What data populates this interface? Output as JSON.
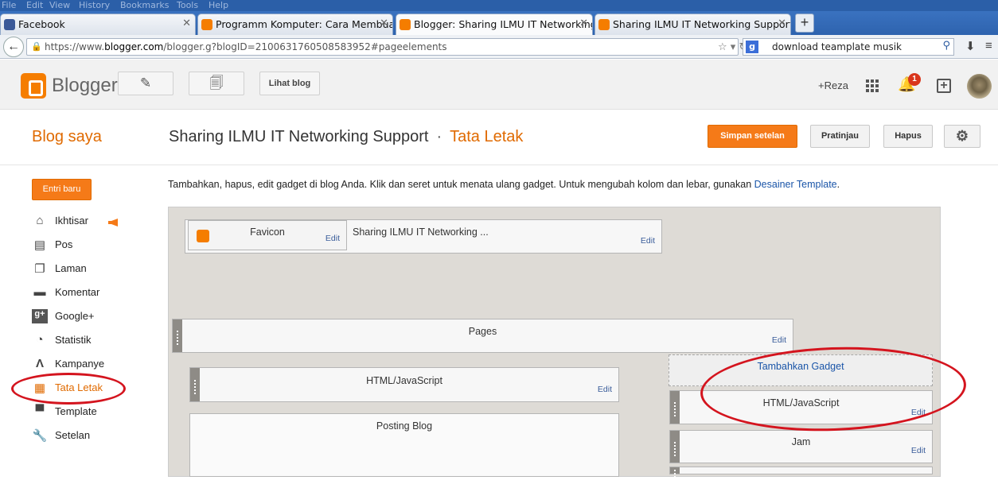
{
  "browser": {
    "menu": [
      "File",
      "Edit",
      "View",
      "History",
      "Bookmarks",
      "Tools",
      "Help"
    ],
    "tabs": [
      {
        "label": "Facebook",
        "color": "#3b5998"
      },
      {
        "label": "Programm Komputer: Cara Membuat...",
        "color": "#f57d00"
      },
      {
        "label": "Blogger: Sharing ILMU IT Networking...",
        "color": "#f57d00"
      },
      {
        "label": "Sharing ILMU IT Networking Support",
        "color": "#f57d00"
      }
    ],
    "url_prefix": "https://www.",
    "url_host": "blogger.com",
    "url_path": "/blogger.g?blogID=2100631760508583952#pageelements",
    "search_value": "download teamplate musik"
  },
  "header": {
    "brand": "Blogger",
    "view_blog": "Lihat blog",
    "user": "+Reza",
    "notification_count": "1"
  },
  "titlebar": {
    "my_blogs": "Blog saya",
    "blog_title": "Sharing ILMU IT Networking Support",
    "separator": "·",
    "section": "Tata Letak",
    "save": "Simpan setelan",
    "preview": "Pratinjau",
    "delete": "Hapus"
  },
  "sidebar": {
    "new_post": "Entri baru",
    "items": [
      {
        "label": "Ikhtisar",
        "icon": "home-icon"
      },
      {
        "label": "Pos",
        "icon": "posts-icon"
      },
      {
        "label": "Laman",
        "icon": "pages-icon"
      },
      {
        "label": "Komentar",
        "icon": "comment-icon"
      },
      {
        "label": "Google+",
        "icon": "google-plus-icon"
      },
      {
        "label": "Statistik",
        "icon": "stats-icon"
      },
      {
        "label": "Kampanye",
        "icon": "campaign-icon"
      },
      {
        "label": "Tata Letak",
        "icon": "layout-icon"
      },
      {
        "label": "Template",
        "icon": "template-icon"
      },
      {
        "label": "Setelan",
        "icon": "wrench-icon"
      }
    ]
  },
  "main": {
    "description": "Tambahkan, hapus, edit gadget di blog Anda. Klik dan seret untuk menata ulang gadget. Untuk mengubah kolom dan lebar, gunakan ",
    "description_link": "Desainer Template",
    "description_end": ".",
    "gadgets": {
      "favicon": "Favicon",
      "header": "Sharing ILMU IT Networking ...",
      "pages": "Pages",
      "html_main": "HTML/JavaScript",
      "posting": "Posting Blog",
      "add_gadget": "Tambahkan Gadget",
      "html_side": "HTML/JavaScript",
      "clock": "Jam",
      "edit": "Edit"
    }
  },
  "colors": {
    "accent": "#f57a18",
    "annotation": "#d4141e",
    "link": "#1a55a8"
  }
}
